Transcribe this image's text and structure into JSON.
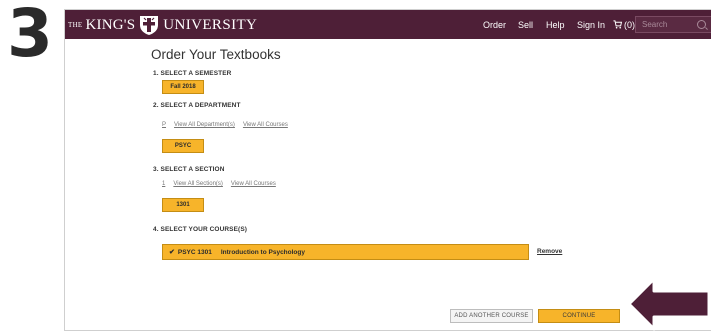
{
  "step_number": "3",
  "header": {
    "logo": {
      "prefix": "THE",
      "name_first": "KING'S",
      "name_second": "UNIVERSITY"
    },
    "nav": {
      "order": "Order",
      "sell": "Sell",
      "help": "Help",
      "sign_in": "Sign In",
      "cart_count": "(0)"
    },
    "search": {
      "placeholder": "Search"
    },
    "colors": {
      "bar": "#4e1f37"
    }
  },
  "main": {
    "title": "Order Your Textbooks",
    "semester": {
      "label": "1. SELECT A SEMESTER",
      "selected": "Fall 2018"
    },
    "department": {
      "label": "2. SELECT A DEPARTMENT",
      "links": [
        "P",
        "View All Department(s)",
        "View All Courses"
      ],
      "selected": "PSYC"
    },
    "section": {
      "label": "3. SELECT A SECTION",
      "links": [
        "1",
        "View All Section(s)",
        "View All Courses"
      ],
      "selected": "1301"
    },
    "courses": {
      "label": "4. SELECT YOUR COURSE(S)",
      "selected_code": "PSYC 1301",
      "selected_name": "Introduction to Psychology",
      "remove_label": "Remove"
    },
    "buttons": {
      "add_another": "ADD ANOTHER COURSE",
      "continue": "CONTINUE"
    },
    "colors": {
      "accent": "#f7b42a",
      "accent_border": "#c48d14",
      "arrow": "#4e1f37"
    }
  }
}
